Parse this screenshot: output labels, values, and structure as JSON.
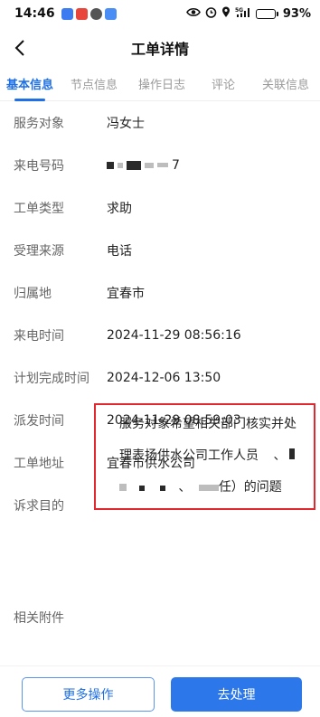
{
  "status_bar": {
    "time": "14:46",
    "network": "5G",
    "battery": "93%",
    "battery_level": 0.93
  },
  "nav": {
    "title": "工单详情"
  },
  "tabs": [
    {
      "label": "基本信息",
      "active": true
    },
    {
      "label": "节点信息",
      "active": false
    },
    {
      "label": "操作日志",
      "active": false
    },
    {
      "label": "评论",
      "active": false
    },
    {
      "label": "关联信息",
      "active": false
    }
  ],
  "fields": {
    "service_target": {
      "label": "服务对象",
      "value": "冯女士"
    },
    "phone": {
      "label": "来电号码",
      "value": "7"
    },
    "order_type": {
      "label": "工单类型",
      "value": "求助"
    },
    "source": {
      "label": "受理来源",
      "value": "电话"
    },
    "region": {
      "label": "归属地",
      "value": "宜春市"
    },
    "call_time": {
      "label": "来电时间",
      "value": "2024-11-29 08:56:16"
    },
    "plan_finish": {
      "label": "计划完成时间",
      "value": "2024-12-06 13:50"
    },
    "dispatch_time": {
      "label": "派发时间",
      "value": "2024-11-29 08:59:03"
    },
    "address": {
      "label": "工单地址",
      "value": "宜春市供水公司"
    },
    "purpose": {
      "label": "诉求目的",
      "line1": "服务对象希望相关部门核实并处",
      "line2": "理表扬供水公司工作人员",
      "line2_tail": "、",
      "line3_mid": "、",
      "line3_tail": "任）的问题"
    },
    "attachments": {
      "label": "相关附件"
    }
  },
  "buttons": {
    "more": "更多操作",
    "process": "去处理"
  },
  "colors": {
    "accent": "#1f6fe5",
    "highlight_border": "#e0282e"
  }
}
